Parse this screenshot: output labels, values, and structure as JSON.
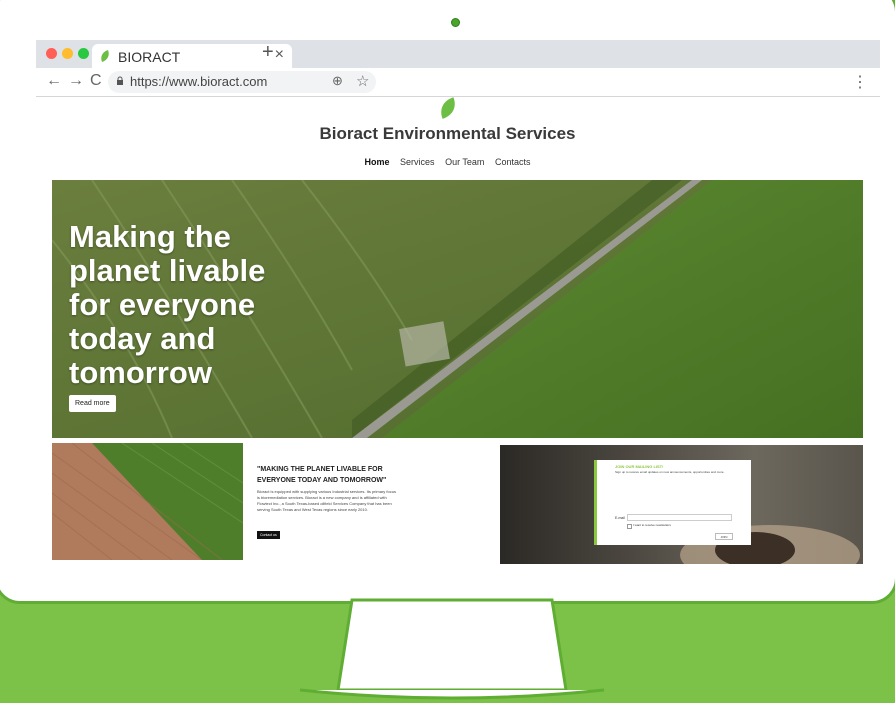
{
  "browser": {
    "tab_title": "BIORACT",
    "tab_close": "×",
    "new_tab": "+",
    "back": "←",
    "forward": "→",
    "reload": "C",
    "url": "https://www.bioract.com",
    "zoom": "⊕",
    "bookmark": "☆",
    "menu": "⋮",
    "traffic_light_colors": [
      "#ff5f57",
      "#febc2e",
      "#28c840"
    ]
  },
  "site": {
    "title": "Bioract Environmental Services",
    "nav": [
      "Home",
      "Services",
      "Our Team",
      "Contacts"
    ],
    "brand_color": "#6dbe45"
  },
  "hero": {
    "headline": "Making the planet livable for everyone today and tomorrow",
    "button": "Read more"
  },
  "about": {
    "heading": "\"MAKING THE PLANET LIVABLE FOR EVERYONE TODAY AND TOMORROW\"",
    "body": "Bioract is equipped with supplying various Industrial services. Its primary focus is bioremediation services. Bioract is a new company and is affiliated with Flowtect Inc., a South Texas-based oilfield Services Company that has been serving South Texas and West Texas regions since early 2010.",
    "button": "Contact us"
  },
  "newsletter": {
    "title": "JOIN OUR MAILING LIST!",
    "description": "Sign up to receive email updates on new announcements, opportunities and more.",
    "email_label": "E-mail",
    "checkbox_label": "I want to receive newsletters",
    "button": "JOIN"
  }
}
